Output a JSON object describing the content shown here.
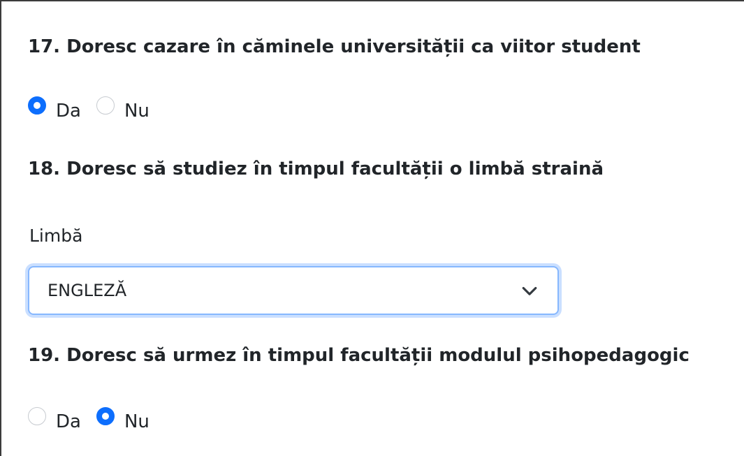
{
  "questions": [
    {
      "title": "17. Doresc cazare în căminele universității ca viitor student",
      "options": [
        "Da",
        "Nu"
      ],
      "selected": "Da"
    },
    {
      "title": "18. Doresc să studiez în timpul facultății o limbă straină",
      "field_label": "Limbă",
      "select_value": "ENGLEZĂ"
    },
    {
      "title": "19. Doresc să urmez în timpul facultății modulul psihopedagogic",
      "options": [
        "Da",
        "Nu"
      ],
      "selected": "Nu"
    }
  ],
  "icons": {
    "select_arrow": "chevron-down-icon"
  },
  "colors": {
    "accent": "#0d6efd",
    "focus_border": "#86b7fe",
    "text": "#212529",
    "frame_border": "#3b3b3b"
  }
}
